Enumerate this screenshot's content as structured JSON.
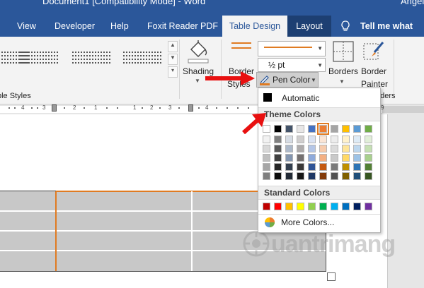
{
  "window": {
    "title": "Document1 [Compatibility Mode] - Word",
    "user": "Angel"
  },
  "tabs": [
    {
      "label": "View"
    },
    {
      "label": "Developer"
    },
    {
      "label": "Help"
    },
    {
      "label": "Foxit Reader PDF"
    },
    {
      "label": "Table Design",
      "active": true
    },
    {
      "label": "Layout"
    }
  ],
  "tell_me": "Tell me what you",
  "ribbon": {
    "table_styles_group": "ble Styles",
    "shading": "Shading",
    "border_styles": [
      "Border",
      "Styles"
    ],
    "line_weight": "½ pt",
    "pen_color": "Pen Color",
    "borders": "Borders",
    "border_painter": [
      "Border",
      "Painter"
    ],
    "borders_group": "Borders"
  },
  "ruler": [
    "4",
    "3",
    "2",
    "1",
    "1",
    "2",
    "3",
    "4",
    "9"
  ],
  "pen_color_menu": {
    "automatic": "Automatic",
    "theme_colors_header": "Theme Colors",
    "theme_colors": [
      "#ffffff",
      "#000000",
      "#44546a",
      "#e7e6e6",
      "#4472c4",
      "#ed7d31",
      "#a5a5a5",
      "#ffc000",
      "#5b9bd5",
      "#70ad47"
    ],
    "theme_shades": [
      [
        "#f2f2f2",
        "#d9d9d9",
        "#bfbfbf",
        "#a6a6a6",
        "#7f7f7f"
      ],
      [
        "#7f7f7f",
        "#595959",
        "#404040",
        "#262626",
        "#0d0d0d"
      ],
      [
        "#d6dce4",
        "#adb9ca",
        "#8496b0",
        "#333f4f",
        "#222a35"
      ],
      [
        "#d0cece",
        "#aeabab",
        "#757171",
        "#3a3838",
        "#171616"
      ],
      [
        "#d9e2f3",
        "#b4c6e7",
        "#8eaadb",
        "#2f5496",
        "#1f3864"
      ],
      [
        "#fbe5d5",
        "#f7cbac",
        "#f4b083",
        "#c55a11",
        "#833c0b"
      ],
      [
        "#ededed",
        "#dbdbdb",
        "#c9c9c9",
        "#7b7b7b",
        "#525252"
      ],
      [
        "#fff2cc",
        "#fee599",
        "#ffd965",
        "#bf9000",
        "#7f6000"
      ],
      [
        "#deebf6",
        "#bdd7ee",
        "#9dc3e6",
        "#2e75b5",
        "#1f4e79"
      ],
      [
        "#e2efd9",
        "#c5e0b3",
        "#a8d08d",
        "#538135",
        "#375623"
      ]
    ],
    "selected_theme_color": "#ed7d31",
    "standard_colors_header": "Standard Colors",
    "standard_colors": [
      "#c00000",
      "#ff0000",
      "#ffc000",
      "#ffff00",
      "#92d050",
      "#00b050",
      "#00b0f0",
      "#0070c0",
      "#002060",
      "#7030a0"
    ],
    "more_colors": "More Colors..."
  },
  "watermark": "uantrimang",
  "accent_colors": {
    "word_blue": "#2b579a",
    "pen_orange": "#e07b22",
    "arrow_red": "#e81010"
  }
}
